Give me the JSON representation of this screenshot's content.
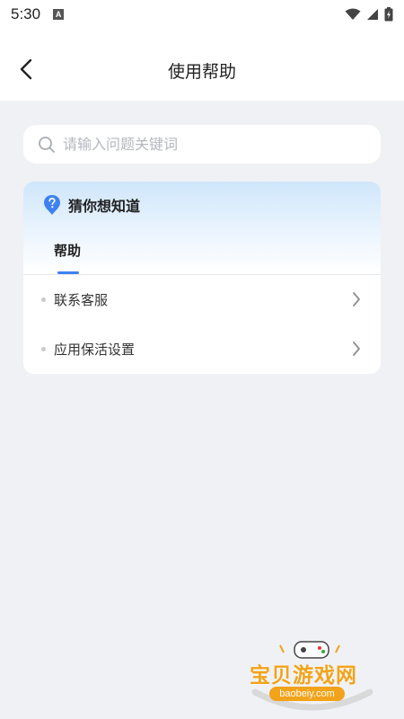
{
  "status_bar": {
    "time": "5:30",
    "a_badge": "A"
  },
  "header": {
    "title": "使用帮助",
    "back_icon": "back-arrow-icon"
  },
  "search": {
    "placeholder": "请输入问题关键词",
    "icon": "search-icon"
  },
  "card": {
    "title": "猜你想知道",
    "icon": "question-icon",
    "accent": "#3d82f0",
    "tabs": [
      {
        "label": "帮助",
        "active": true
      }
    ],
    "items": [
      {
        "label": "联系客服"
      },
      {
        "label": "应用保活设置"
      }
    ]
  },
  "watermark": {
    "text": "宝贝游戏网",
    "url": "baobeiy.com"
  }
}
